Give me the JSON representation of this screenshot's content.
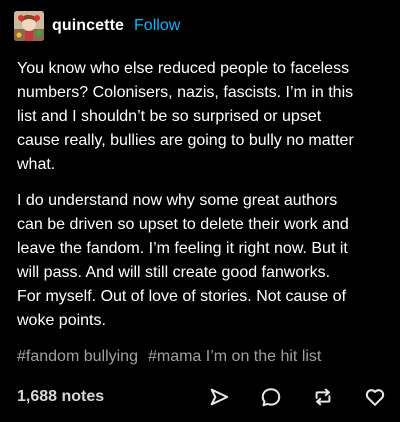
{
  "post": {
    "author": {
      "username": "quincette",
      "follow_label": "Follow",
      "avatar_icon": "avatar-image"
    },
    "paragraphs": [
      "You know who else reduced people to faceless\nnumbers? Colonisers, nazis, fascists. I’m in this\nlist and I shouldn’t be so surprised or upset\ncause really, bullies are going to bully no matter\nwhat.",
      "I do understand now why some great authors\ncan be driven so upset to delete their work and\nleave the fandom. I’m feeling it right now. But it\nwill pass. And will still create good fanworks.\nFor myself. Out of love of stories. Not cause of\nwoke points."
    ],
    "tags": [
      "#fandom bullying",
      "#mama I’m on the hit list"
    ],
    "notes_label": "1,688 notes",
    "actions": [
      "share-icon",
      "reply-icon",
      "reblog-icon",
      "like-icon"
    ]
  },
  "colors": {
    "background": "#000000",
    "text": "#ffffff",
    "accent": "#00b8ff",
    "tag": "#a0a0a0",
    "icon": "#e6e6e6"
  }
}
